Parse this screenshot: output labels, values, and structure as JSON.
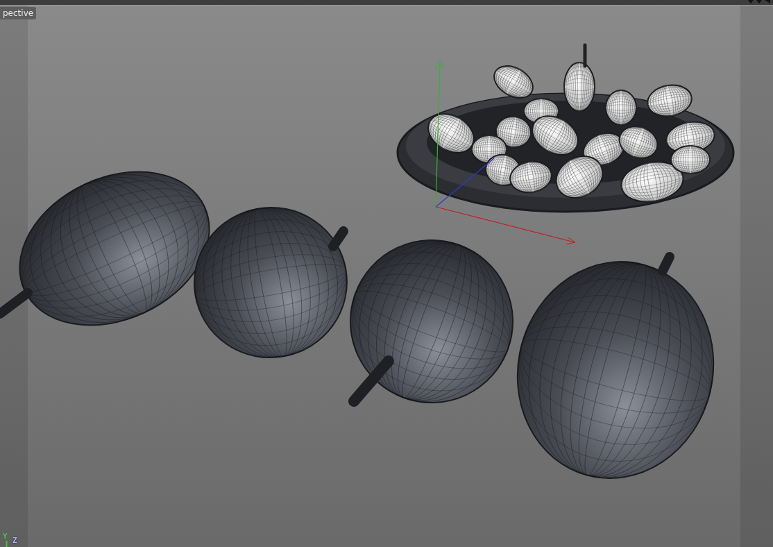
{
  "viewport": {
    "camera_label": "pective"
  },
  "axis_labels": [
    "Y",
    "Z"
  ]
}
